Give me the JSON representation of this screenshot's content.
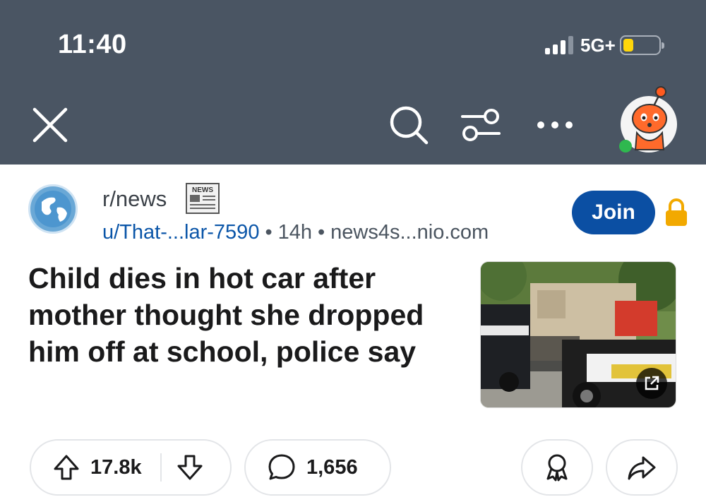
{
  "status_bar": {
    "time": "11:40",
    "network": "5G+",
    "battery_level": 0.3,
    "battery_color": "#ffd60a"
  },
  "toolbar": {
    "close_icon": "close-icon",
    "search_icon": "search-icon",
    "filter_icon": "filter-icon",
    "more_icon": "more-icon",
    "avatar_status_color": "#2fb84f",
    "background": "#4a5563"
  },
  "post": {
    "subreddit": "r/news",
    "badge_text": "NEWS",
    "author": "u/That-...lar-7590",
    "age": "14h",
    "domain": "news4s...nio.com",
    "join_label": "Join",
    "title": "Child dies in hot car after mother thought she dropped him off at school, police say",
    "upvotes": "17.8k",
    "comments": "1,656",
    "accent_color": "#0b4fa3"
  }
}
